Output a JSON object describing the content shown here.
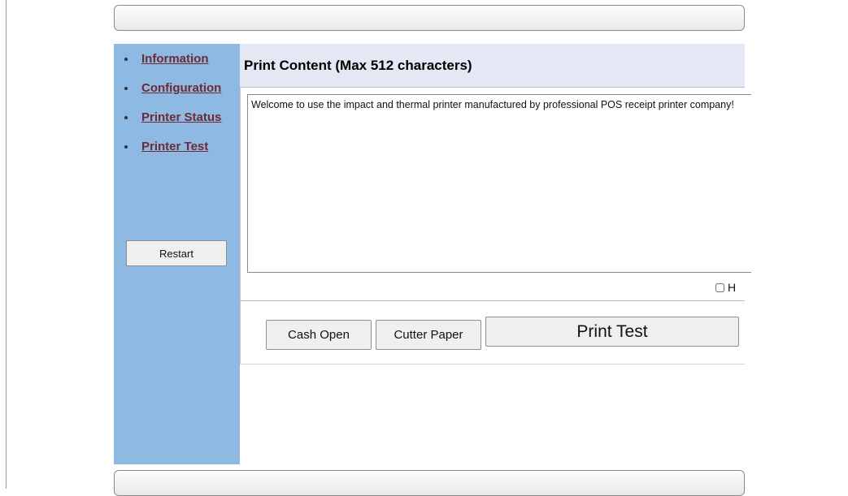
{
  "sidebar": {
    "items": [
      {
        "label": "Information"
      },
      {
        "label": "Configuration"
      },
      {
        "label": "Printer Status"
      },
      {
        "label": "Printer Test"
      }
    ],
    "restart_label": "Restart"
  },
  "main": {
    "title": "Print Content (Max 512 characters)",
    "print_content": "Welcome to use the impact and thermal printer manufactured by professional POS receipt printer company!",
    "hex_checkbox_label": "H",
    "hex_checked": false,
    "buttons": {
      "cash_open": "Cash Open",
      "cutter_paper": "Cutter Paper",
      "print_test": "Print Test"
    }
  },
  "colors": {
    "sidebar_bg": "#8db9e2",
    "link": "#6f2a33",
    "header_bg": "#e4e8f4"
  }
}
